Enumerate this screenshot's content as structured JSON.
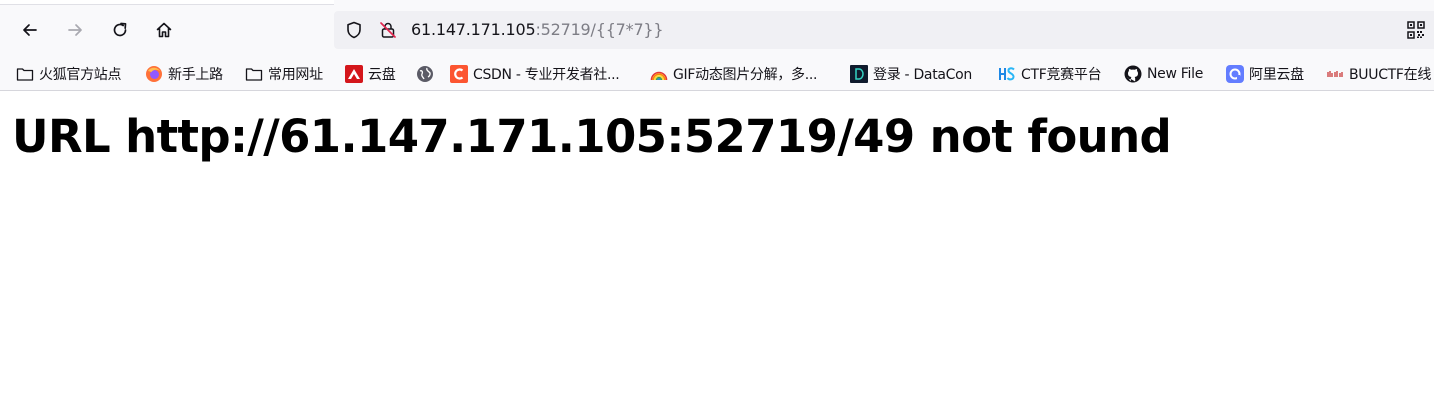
{
  "urlbar": {
    "host": "61.147.171.105",
    "rest": ":52719/{{7*7}}"
  },
  "bookmarks": [
    {
      "label": "火狐官方站点",
      "icon": "folder-icon"
    },
    {
      "label": "新手上路",
      "icon": "firefox-icon"
    },
    {
      "label": "常用网址",
      "icon": "folder-icon"
    },
    {
      "label": "云盘",
      "icon": "cloud-drive-icon"
    },
    {
      "label": "",
      "icon": "globe-icon"
    },
    {
      "label": "CSDN - 专业开发者社...",
      "icon": "csdn-icon"
    },
    {
      "label": "GIF动态图片分解，多...",
      "icon": "rainbow-icon"
    },
    {
      "label": "登录 - DataCon",
      "icon": "datacon-icon"
    },
    {
      "label": "CTF竞赛平台",
      "icon": "ctf-hs-icon"
    },
    {
      "label": "New File",
      "icon": "github-icon"
    },
    {
      "label": "阿里云盘",
      "icon": "aliyun-drive-icon"
    },
    {
      "label": "BUUCTF在线",
      "icon": "buuctf-icon"
    }
  ],
  "page": {
    "heading": "URL http://61.147.171.105:52719/49 not found"
  },
  "colors": {
    "toolbar_bg": "#f9f9fb",
    "urlbar_bg": "#f0f0f4",
    "text": "#15141a",
    "url_dim": "#7d7d85"
  }
}
